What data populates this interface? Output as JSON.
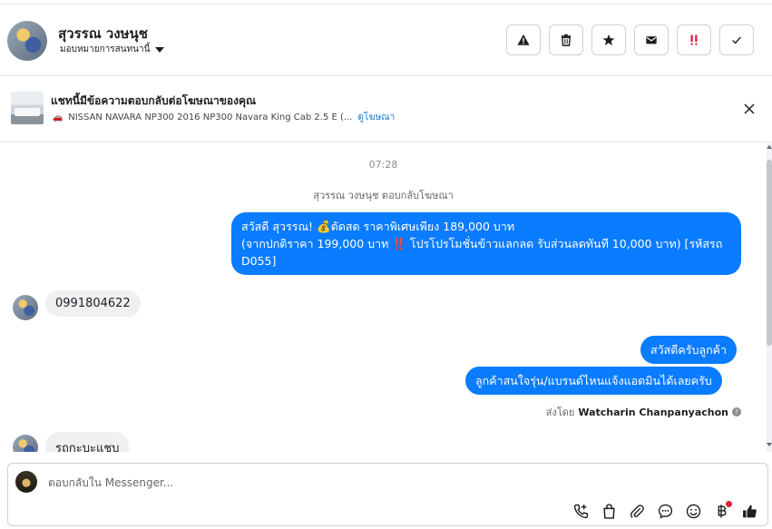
{
  "header": {
    "contact_name": "สุวรรณ วงษนุช",
    "assign_label": "มอบหมายการสนทนานี้",
    "actions": [
      {
        "name": "spam-button",
        "icon": "warning-icon"
      },
      {
        "name": "delete-button",
        "icon": "trash-icon"
      },
      {
        "name": "star-button",
        "icon": "star-icon"
      },
      {
        "name": "mark-unread-button",
        "icon": "mail-icon"
      },
      {
        "name": "follow-up-button",
        "icon": "double-exclamation-icon"
      },
      {
        "name": "done-button",
        "icon": "check-icon"
      }
    ]
  },
  "ad": {
    "title": "แชทนี้มีข้อความตอบกลับต่อโฆษณาของคุณ",
    "car_icon": "🚗",
    "description": "NISSAN NAVARA NP300 2016 NP300 Navara King Cab 2.5 E (...",
    "link": "ดูโฆษณา"
  },
  "chat": {
    "time": "07:28",
    "system_note": "สุวรรณ วงษนุช ตอบกลับโฆษณา",
    "messages": {
      "m1_line1": "สวัสดี สุวรรณ! 💰ตัดสด ราคาพิเศษเพียง 189,000 บาท",
      "m1_line2": "(จากปกติราคา 199,000 บาท ‼️ โปรโปรโมชั่นข้าวแลกลด รับส่วนลดทันที 10,000 บาท) [รหัสรถ D055]",
      "m2": "0991804622",
      "m3": "สวัสดีครับลูกค้า",
      "m4": "ลูกค้าสนใจรุ่น/แบรนด์ไหนแจ้งแอดมินได้เลยครับ",
      "m5": "รถกะบะแชบ"
    },
    "sent_by_prefix": "ส่งโดย",
    "sent_by_name": "Watcharin Chanpanyachon"
  },
  "composer": {
    "placeholder": "ตอบกลับใน Messenger...",
    "tools": [
      "phone-add-icon",
      "bag-icon",
      "paperclip-icon",
      "chat-bubble-icon",
      "smiley-icon",
      "baht-icon",
      "thumbs-up-icon"
    ]
  },
  "colors": {
    "accent_blue": "#0a7cff",
    "incoming_bg": "#eff0f2",
    "link_blue": "#1a73c8",
    "alert_red": "#e41e3f"
  }
}
